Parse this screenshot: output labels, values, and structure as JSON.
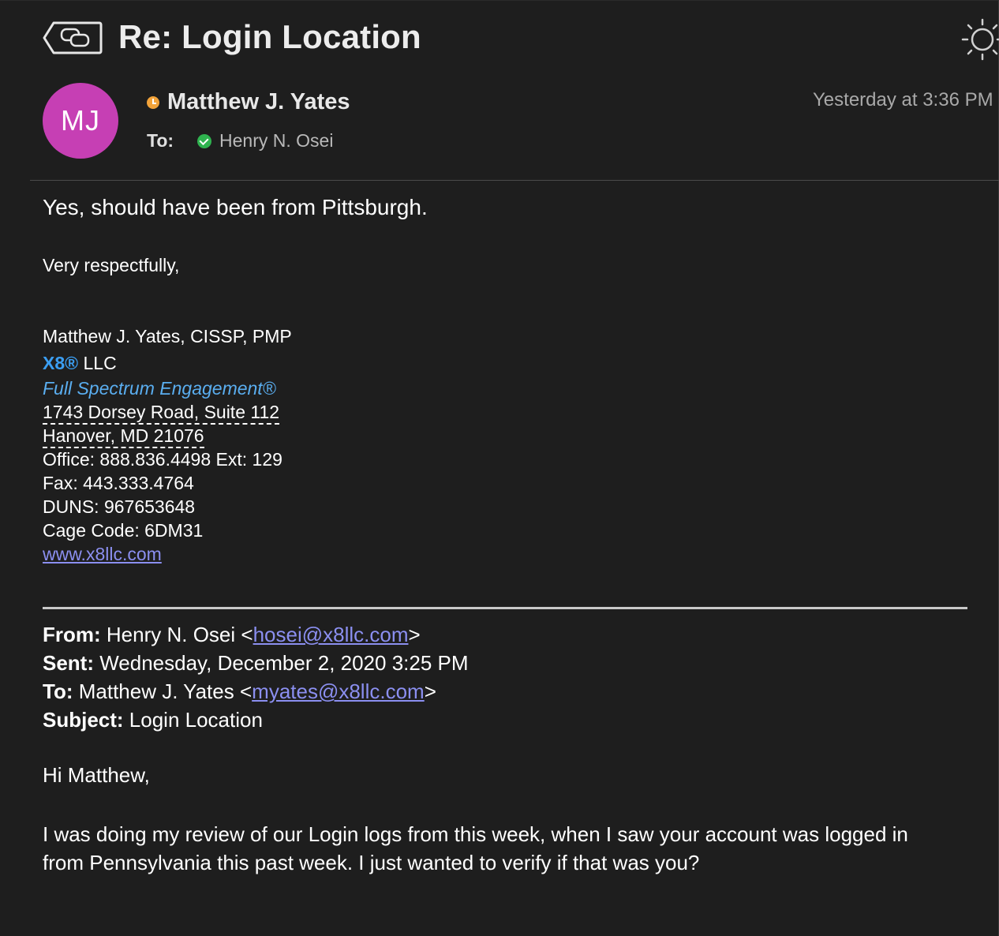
{
  "header": {
    "subject": "Re: Login Location"
  },
  "message": {
    "avatar_initials": "MJ",
    "sender_name": "Matthew J. Yates",
    "timestamp": "Yesterday at 3:36 PM",
    "to_label": "To:",
    "recipient": "Henry N. Osei"
  },
  "body": {
    "lead": "Yes, should have been from Pittsburgh.",
    "regards": "Very respectfully,"
  },
  "signature": {
    "name": "Matthew J. Yates, CISSP, PMP",
    "brand": "X8®",
    "company_suffix": " LLC",
    "tagline": "Full Spectrum Engagement®",
    "address1": "1743 Dorsey Road, Suite 112",
    "address2": "Hanover, MD 21076",
    "office": "Office:  888.836.4498  Ext: 129",
    "fax": "Fax: 443.333.4764",
    "duns": "DUNS: 967653648",
    "cage": "Cage Code:  6DM31",
    "website": "www.x8llc.com"
  },
  "quoted": {
    "from_label": "From:",
    "from_name": " Henry N. Osei <",
    "from_email": "hosei@x8llc.com",
    "from_close": ">",
    "sent_label": "Sent:",
    "sent_value": " Wednesday, December 2, 2020 3:25 PM",
    "to_label": "To:",
    "to_name": " Matthew J. Yates <",
    "to_email": "myates@x8llc.com",
    "to_close": ">",
    "subject_label": "Subject:",
    "subject_value": " Login Location",
    "greeting": "Hi Matthew,",
    "paragraph_line1": "I was doing my review of our Login logs from this week, when I saw your account was logged in",
    "paragraph_line2": "from Pennsylvania this past week. I just wanted to verify if that was you?"
  },
  "icons": {
    "thread": "conversation-back-icon",
    "appearance": "sun-icon",
    "sender_status": "away-clock-icon",
    "recipient_status": "available-check-icon"
  },
  "colors": {
    "background": "#1e1e1e",
    "avatar": "#c63fb4",
    "brand_blue": "#3b9ef2",
    "link": "#8b8ff0",
    "status_away": "#f2a33a",
    "status_available": "#2fb34f"
  }
}
